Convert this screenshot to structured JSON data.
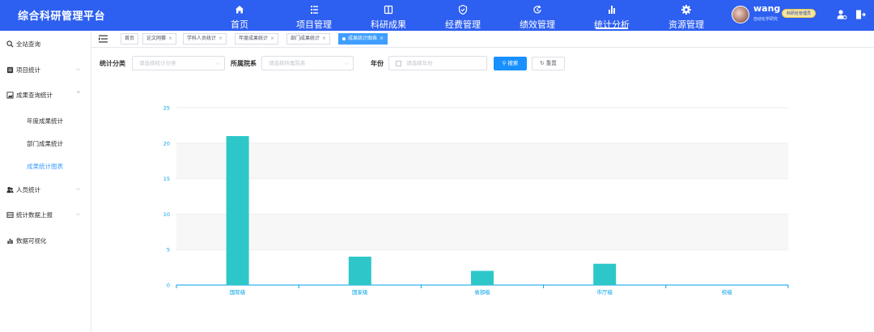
{
  "app": {
    "title": "综合科研管理平台"
  },
  "nav": [
    {
      "label": "首页",
      "icon": "home-icon"
    },
    {
      "label": "项目管理",
      "icon": "list-icon"
    },
    {
      "label": "科研成果",
      "icon": "book-icon"
    },
    {
      "label": "经费管理",
      "icon": "shield-icon"
    },
    {
      "label": "绩效管理",
      "icon": "refresh-icon"
    },
    {
      "label": "统计分析",
      "icon": "bar-chart-icon",
      "active": true
    },
    {
      "label": "资源管理",
      "icon": "gear-icon"
    }
  ],
  "user": {
    "name": "wang",
    "role": "科研处管理员",
    "sub": "自动化学研究"
  },
  "sidebar": {
    "search": "全站查询",
    "items": [
      {
        "label": "项目统计"
      },
      {
        "label": "成果查询统计",
        "expanded": true
      },
      {
        "label": "人员统计"
      },
      {
        "label": "统计数据上报"
      },
      {
        "label": "数据可视化"
      }
    ],
    "subitems": [
      {
        "label": "年度成果统计"
      },
      {
        "label": "部门成果统计"
      },
      {
        "label": "成果统计图表",
        "active": true
      }
    ]
  },
  "tabs": [
    {
      "label": "首页",
      "closable": false
    },
    {
      "label": "论文网赛",
      "closable": true
    },
    {
      "label": "学科人员统计",
      "closable": true
    },
    {
      "label": "年度成果统计",
      "closable": true
    },
    {
      "label": "部门成果统计",
      "closable": true
    },
    {
      "label": "成果统计图表",
      "closable": true,
      "active": true
    }
  ],
  "filters": {
    "category_label": "统计分类",
    "category_placeholder": "请选择统计分类",
    "dept_label": "所属院系",
    "dept_placeholder": "请选择所属院系",
    "year_label": "年份",
    "year_placeholder": "请选择年份",
    "search_button": "搜索",
    "reset_button": "重置"
  },
  "colors": {
    "topbar": "#2d5ff0",
    "accent": "#409eff",
    "bar": "#2ec7c9",
    "axis": "#00a0e9"
  },
  "chart_data": {
    "type": "bar",
    "categories": [
      "国际级",
      "国家级",
      "省部级",
      "市厅级",
      "校级"
    ],
    "values": [
      21,
      4,
      2,
      3,
      0
    ],
    "ylim": [
      0,
      25
    ],
    "yticks": [
      0,
      5,
      10,
      15,
      20,
      25
    ],
    "grid": true,
    "legend": "none"
  }
}
